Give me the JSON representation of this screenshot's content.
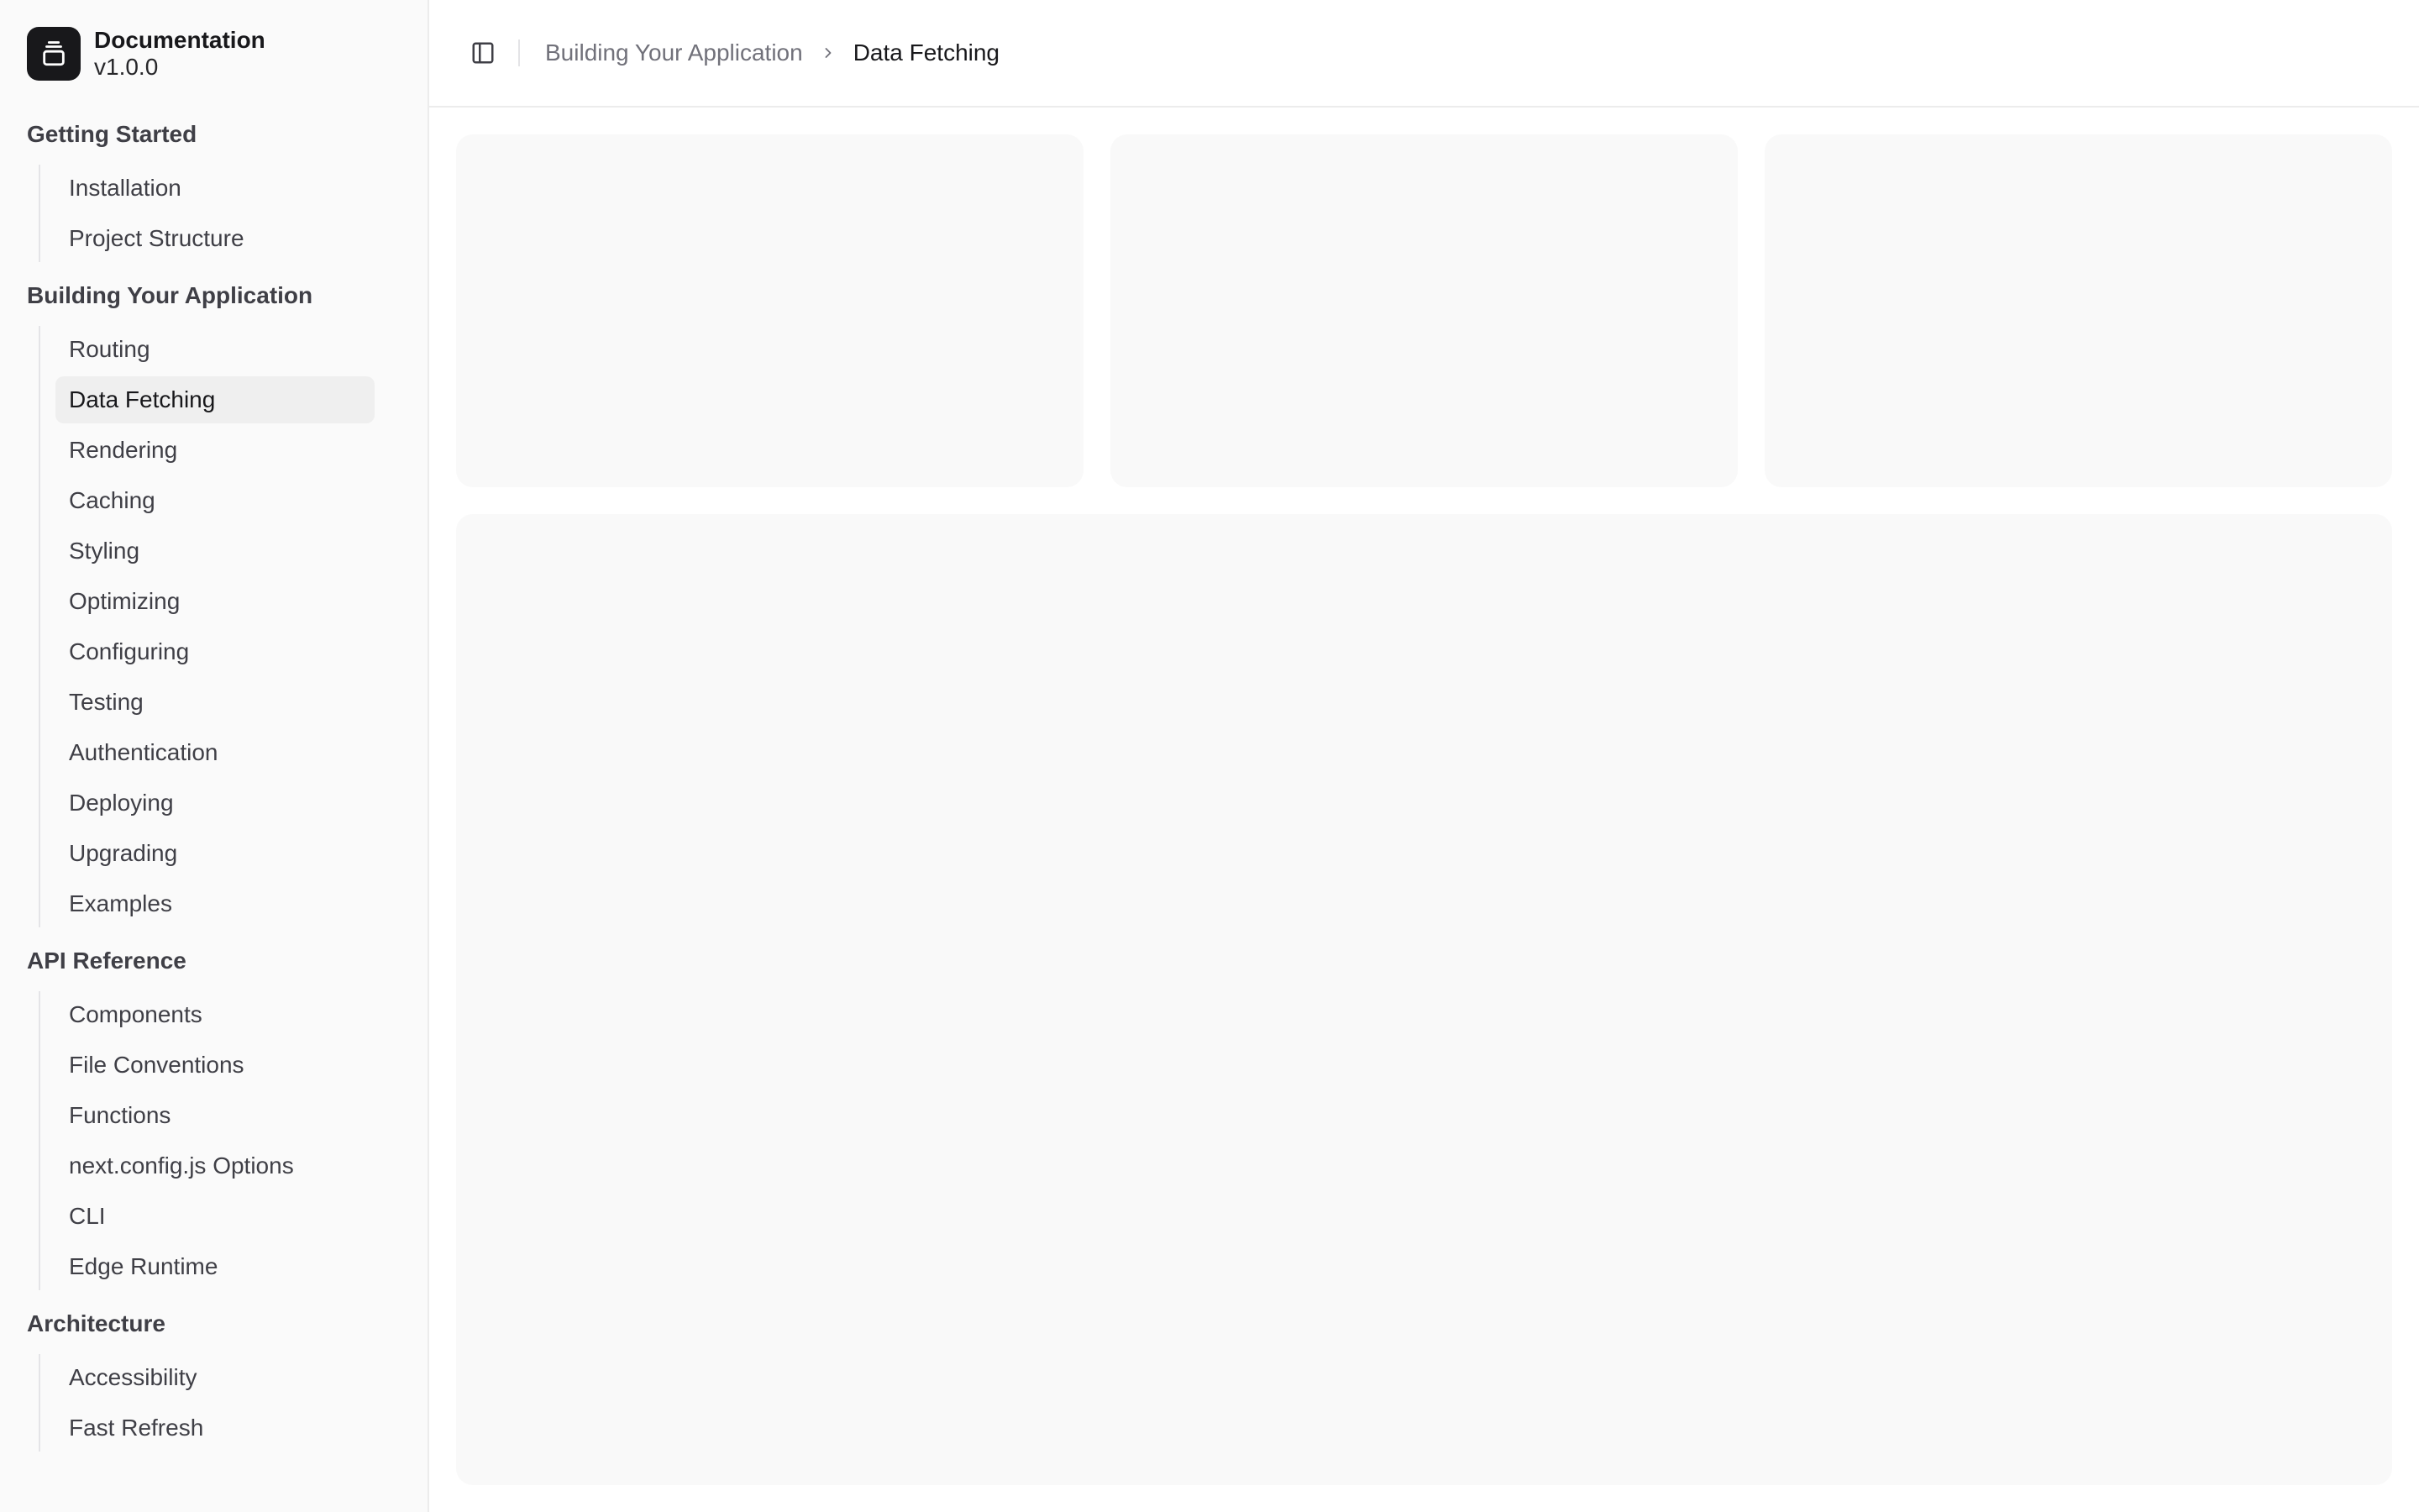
{
  "brand": {
    "title": "Documentation",
    "version": "v1.0.0",
    "icon": "gallery-icon"
  },
  "sidebar": {
    "groups": [
      {
        "title": "Getting Started",
        "items": [
          "Installation",
          "Project Structure"
        ]
      },
      {
        "title": "Building Your Application",
        "items": [
          "Routing",
          "Data Fetching",
          "Rendering",
          "Caching",
          "Styling",
          "Optimizing",
          "Configuring",
          "Testing",
          "Authentication",
          "Deploying",
          "Upgrading",
          "Examples"
        ]
      },
      {
        "title": "API Reference",
        "items": [
          "Components",
          "File Conventions",
          "Functions",
          "next.config.js Options",
          "CLI",
          "Edge Runtime"
        ]
      },
      {
        "title": "Architecture",
        "items": [
          "Accessibility",
          "Fast Refresh"
        ]
      }
    ],
    "active_item": "Data Fetching"
  },
  "breadcrumb": {
    "parent": "Building Your Application",
    "current": "Data Fetching"
  },
  "colors": {
    "sidebar_bg": "#fafafa",
    "placeholder_bg": "#f9f9f9",
    "logo_bg": "#18181b"
  }
}
